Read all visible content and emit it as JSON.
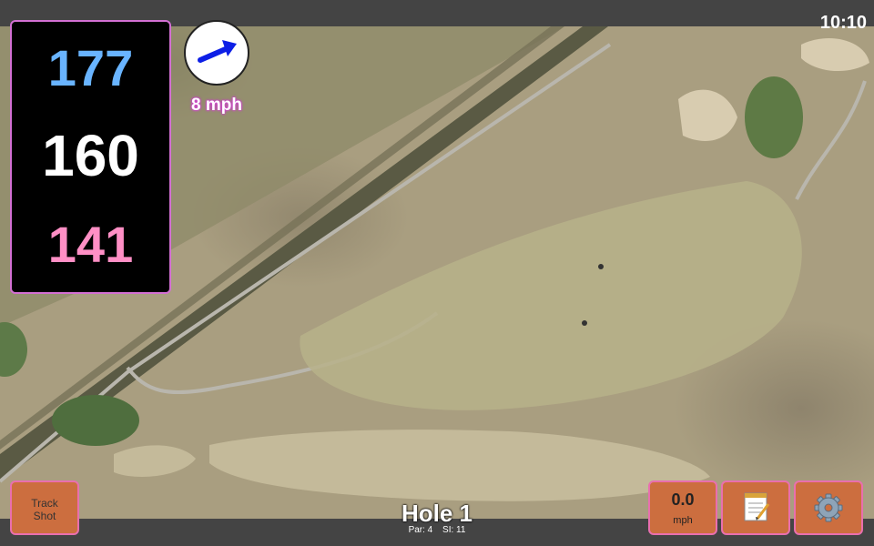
{
  "status": {
    "time": "10:10"
  },
  "distances": {
    "back": "177",
    "middle": "160",
    "front": "141"
  },
  "wind": {
    "speed": "8 mph",
    "direction_icon": "wind-arrow-icon"
  },
  "buttons": {
    "track_shot_line1": "Track",
    "track_shot_line2": "Shot",
    "speed_value": "0.0",
    "speed_unit": "mph",
    "notes_icon": "notepad-icon",
    "settings_icon": "gear-icon"
  },
  "hole": {
    "title": "Hole 1",
    "par": "Par: 4",
    "si": "SI: 11"
  },
  "colors": {
    "back": "#69b4ff",
    "middle": "#ffffff",
    "front": "#ff8fc5",
    "accent_border": "#e96fae",
    "button_bg": "#cc6e3f"
  }
}
